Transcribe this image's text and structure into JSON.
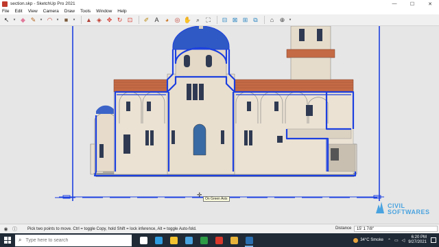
{
  "window": {
    "title": "section.skp - SketchUp Pro 2021",
    "controls": [
      "—",
      "☐",
      "✕"
    ]
  },
  "menu": [
    "File",
    "Edit",
    "View",
    "Camera",
    "Draw",
    "Tools",
    "Window",
    "Help"
  ],
  "toolbar": [
    {
      "icon": "select-arrow-icon",
      "glyph": "↖",
      "color": "#222222"
    },
    {
      "icon": "dropdown-icon",
      "glyph": "▾",
      "color": "#444444",
      "dd": true
    },
    {
      "icon": "eraser-icon",
      "glyph": "◆",
      "color": "#e07a9b"
    },
    {
      "icon": "pencil-icon",
      "glyph": "✎",
      "color": "#b5651d"
    },
    {
      "icon": "dropdown-icon",
      "glyph": "▾",
      "color": "#444444",
      "dd": true
    },
    {
      "icon": "arc-icon",
      "glyph": "◠",
      "color": "#c0392b"
    },
    {
      "icon": "dropdown-icon",
      "glyph": "▾",
      "color": "#444444",
      "dd": true
    },
    {
      "icon": "shape-icon",
      "glyph": "■",
      "color": "#7a5a3a"
    },
    {
      "icon": "dropdown-icon",
      "glyph": "▾",
      "color": "#444444",
      "dd": true
    },
    {
      "icon": "push-pull-icon",
      "glyph": "▲",
      "color": "#b0463c"
    },
    {
      "icon": "offset-icon",
      "glyph": "◈",
      "color": "#c0392b"
    },
    {
      "icon": "move-icon",
      "glyph": "✥",
      "color": "#d43a2f"
    },
    {
      "icon": "rotate-icon",
      "glyph": "↻",
      "color": "#d43a2f"
    },
    {
      "icon": "scale-icon",
      "glyph": "⊡",
      "color": "#d43a2f"
    },
    {
      "icon": "tape-measure-icon",
      "glyph": "✐",
      "color": "#b8860b"
    },
    {
      "icon": "text-icon",
      "glyph": "A",
      "color": "#333333"
    },
    {
      "icon": "paint-bucket-icon",
      "glyph": "◕",
      "color": "#c97b2b"
    },
    {
      "icon": "orbit-icon",
      "glyph": "◎",
      "color": "#c0392b"
    },
    {
      "icon": "pan-icon",
      "glyph": "✋",
      "color": "#8a5a2b"
    },
    {
      "icon": "zoom-icon",
      "glyph": "⌕",
      "color": "#333333"
    },
    {
      "icon": "zoom-extents-icon",
      "glyph": "⛶",
      "color": "#333333"
    },
    {
      "icon": "section-plane-icon",
      "glyph": "⊟",
      "color": "#2e86c1"
    },
    {
      "icon": "section-fill-icon",
      "glyph": "⊠",
      "color": "#2e86c1"
    },
    {
      "icon": "section-display-icon",
      "glyph": "⊞",
      "color": "#2e86c1"
    },
    {
      "icon": "section-cut-icon",
      "glyph": "⧉",
      "color": "#2e86c1"
    },
    {
      "icon": "warehouse-icon",
      "glyph": "⌂",
      "color": "#444444"
    },
    {
      "icon": "extension-icon",
      "glyph": "⊕",
      "color": "#444444"
    },
    {
      "icon": "dropdown-icon",
      "glyph": "▾",
      "color": "#444444",
      "dd": true
    }
  ],
  "viewport": {
    "tooltip": "On Green Axis",
    "background": "#e6e6e6",
    "section_color": "#1b3fe0"
  },
  "watermark": {
    "line1": "CIVIL",
    "line2": "SOFTWARES"
  },
  "status": {
    "message": "Pick two points to move.  Ctrl = toggle Copy, hold Shift = lock inference, Alt = toggle Auto-fold.",
    "measure_label": "Distance",
    "measure_value": "15' 1 7/8\""
  },
  "taskbar": {
    "search_placeholder": "Type here to search",
    "apps": [
      {
        "name": "task-view-icon",
        "color": "#ffffff"
      },
      {
        "name": "edge-icon",
        "color": "#2f9ce0"
      },
      {
        "name": "file-explorer-icon",
        "color": "#f2c230"
      },
      {
        "name": "store-icon",
        "color": "#4aa3df"
      },
      {
        "name": "camtasia-icon",
        "color": "#2d9a45"
      },
      {
        "name": "app-red-icon",
        "color": "#d9382b"
      },
      {
        "name": "chrome-icon",
        "color": "#e8b33a"
      },
      {
        "name": "sketchup-icon",
        "color": "#2a6fb0"
      }
    ],
    "weather": "34°C  Smoke",
    "time": "6:20 PM",
    "date": "9/27/2021"
  }
}
